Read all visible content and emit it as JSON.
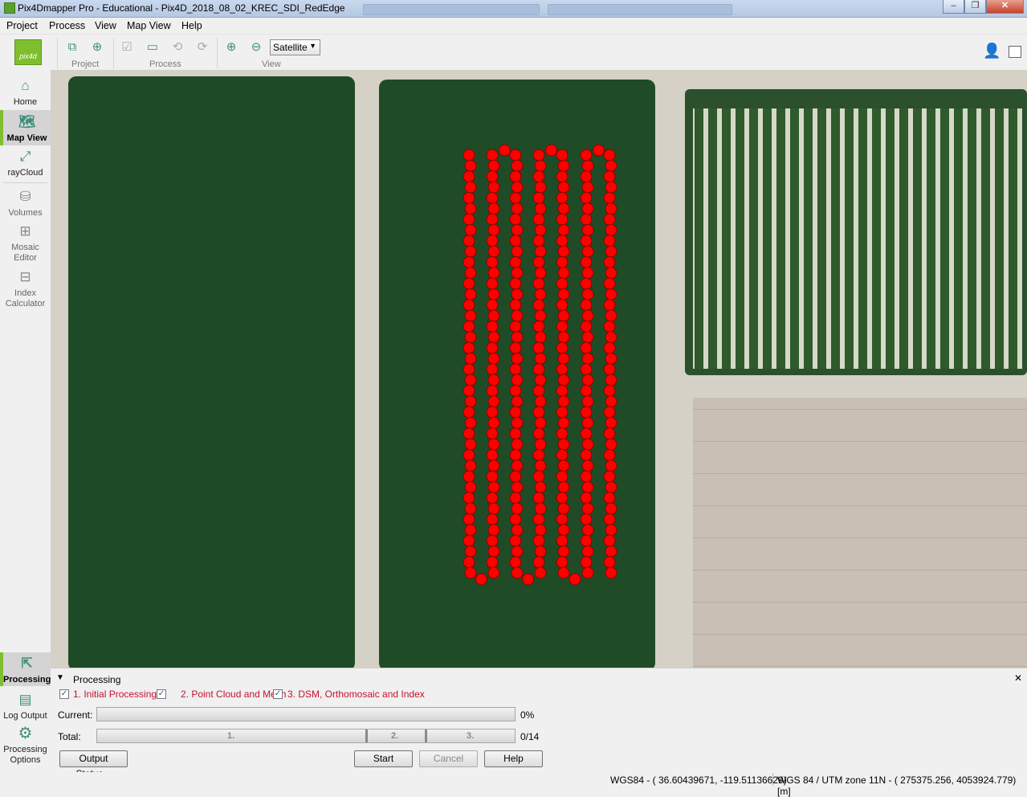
{
  "window": {
    "title": "Pix4Dmapper Pro - Educational - Pix4D_2018_08_02_KREC_SDI_RedEdge",
    "controls": [
      "minimize-icon",
      "restore-icon",
      "close-icon"
    ]
  },
  "menu": [
    "Project",
    "Process",
    "View",
    "Map View",
    "Help"
  ],
  "toolbar": {
    "groups": {
      "project": "Project",
      "process": "Process",
      "view": "View"
    },
    "basemap": {
      "selected": "Satellite"
    },
    "icons": [
      "new-project-icon",
      "add-gcp-icon",
      "process-check-icon",
      "open-folder-icon",
      "rerun-icon",
      "export-icon",
      "zoom-in-icon",
      "zoom-out-icon",
      "user-account-icon",
      "window-layout-icon"
    ]
  },
  "sidebar": {
    "items": [
      {
        "label": "Home",
        "icon": "home-icon"
      },
      {
        "label": "Map View",
        "icon": "map-icon",
        "active": true
      },
      {
        "label": "rayCloud",
        "icon": "raycloud-icon"
      },
      {
        "label": "Volumes",
        "icon": "volumes-icon"
      },
      {
        "label": "Mosaic Editor",
        "icon": "mosaic-editor-icon"
      },
      {
        "label": "Index Calculator",
        "icon": "index-calculator-icon"
      },
      {
        "label": "Processing",
        "icon": "processing-icon",
        "active": true
      },
      {
        "label": "Log Output",
        "icon": "log-output-icon"
      },
      {
        "label": "Processing Options",
        "icon": "processing-options-icon"
      }
    ]
  },
  "map": {
    "layer": "Satellite",
    "flight_markers": {
      "color": "#ff0000",
      "stroke": "#8a0000",
      "lines": 7,
      "points_per_line": 40
    }
  },
  "processing": {
    "header": "Processing",
    "steps": [
      {
        "label": "1. Initial Processing",
        "checked": true
      },
      {
        "label": "2. Point Cloud and Mesh",
        "checked": true
      },
      {
        "label": "3. DSM, Orthomosaic and Index",
        "checked": true
      }
    ],
    "current_label": "Current:",
    "current_percent": "0%",
    "current_progress": 0,
    "total_label": "Total:",
    "total_value": "0/14",
    "total_progress": 0,
    "segment_labels": [
      "1.",
      "2.",
      "3."
    ],
    "buttons": {
      "output_status": "Output Status...",
      "start": "Start",
      "cancel": "Cancel",
      "help": "Help"
    }
  },
  "status": {
    "wgs84": "WGS84 - ( 36.60439671, -119.51136629)",
    "utm": "WGS 84 / UTM zone 11N - (   275375.256,   4053924.779) [m]"
  }
}
